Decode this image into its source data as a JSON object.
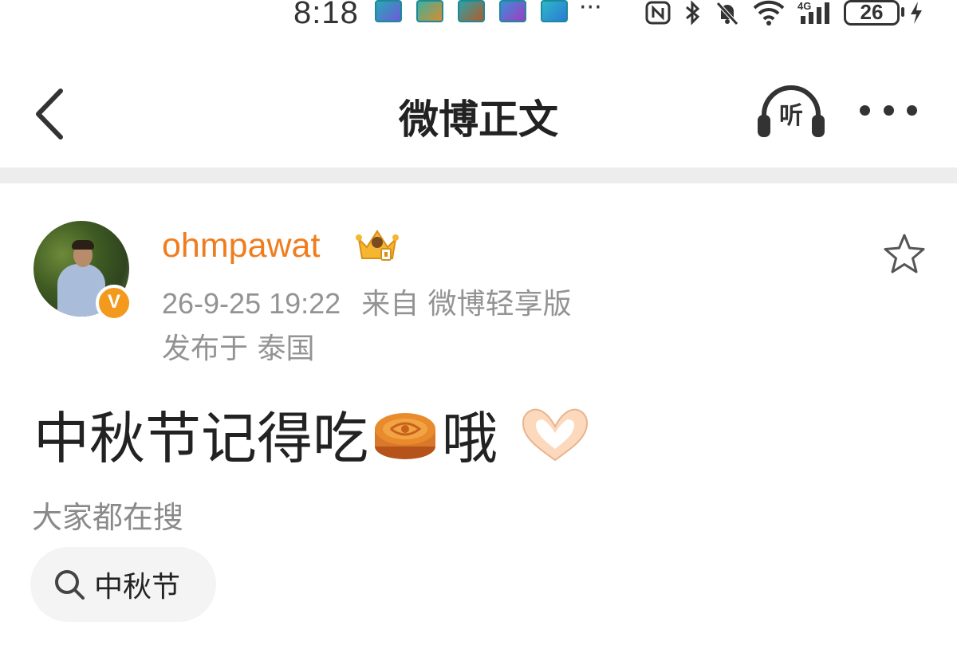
{
  "status_bar": {
    "time": "8:18",
    "more_indicator": "···",
    "battery_level": "26",
    "notification_icons": [
      "app-notification-icon",
      "app-notification-icon",
      "app-notification-icon",
      "app-notification-icon",
      "app-notification-icon"
    ],
    "system_icons": [
      "nfc-icon",
      "bluetooth-icon",
      "mute-bell-icon",
      "wifi-icon",
      "signal-4g-icon",
      "battery-icon",
      "charging-icon"
    ]
  },
  "header": {
    "back_icon": "chevron-left-icon",
    "title": "微博正文",
    "listen_label": "听",
    "more_icon": "more-dots-icon"
  },
  "post": {
    "username": "ohmpawat",
    "username_color": "#ef7d1f",
    "verified_badge": "V",
    "badge_color": "#f39a1e",
    "time": "26-9-25 19:22",
    "source": "来自 微博轻享版",
    "location": "发布于 泰国",
    "text_part1": "中秋节记得吃",
    "text_part2": "哦",
    "emoji_icons": [
      "mooncake-icon",
      "heart-hands-icon"
    ],
    "favorite_icon": "star-outline-icon"
  },
  "search": {
    "caption": "大家都在搜",
    "chips": [
      {
        "icon": "search-icon",
        "label": "中秋节"
      }
    ]
  }
}
